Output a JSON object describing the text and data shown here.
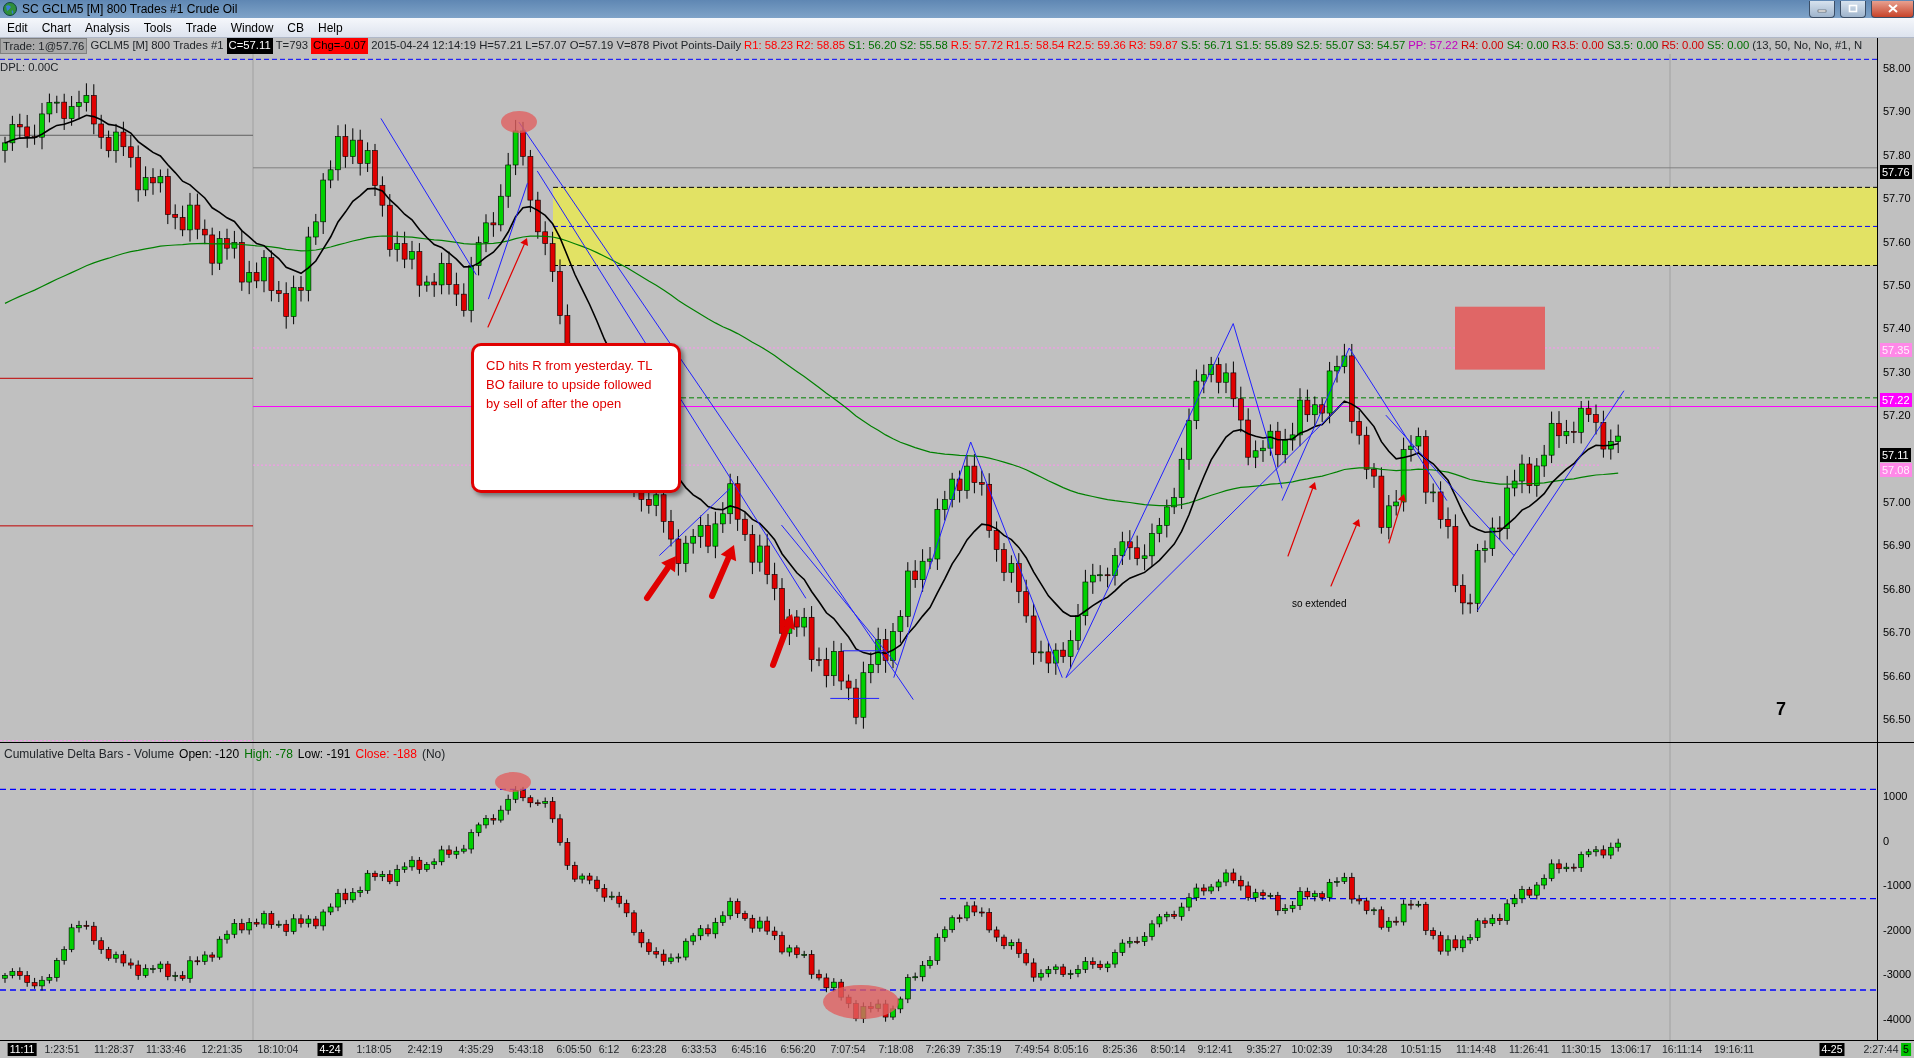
{
  "window": {
    "title": "SC GCLM5 [M]  800 Trades  #1  Crude Oil"
  },
  "menu": [
    "Edit",
    "Chart",
    "Analysis",
    "Tools",
    "Trade",
    "Window",
    "CB",
    "Help"
  ],
  "info_bar": [
    {
      "text": "Trade: 1@57.76",
      "kind": "boxed"
    },
    {
      "text": "GCLM5 [M]  800 Trades  #1",
      "kind": "plain"
    },
    {
      "text": "C=57.11",
      "kind": "inverse"
    },
    {
      "text": "T=793",
      "kind": "plain"
    },
    {
      "text": "Chg=-0.07",
      "kind": "alert"
    },
    {
      "text": "2015-04-24 12:14:19 H=57.21 L=57.07 O=57.19 V=878 Pivot Points-Daily",
      "kind": "plain"
    }
  ],
  "pivot_levels": [
    {
      "text": "R1: 58.23",
      "color": "#ff0000"
    },
    {
      "text": "R2: 58.85",
      "color": "#ff0000"
    },
    {
      "text": "S1: 56.20",
      "color": "#007000"
    },
    {
      "text": "S2: 55.58",
      "color": "#007000"
    },
    {
      "text": "R.5: 57.72",
      "color": "#ff0000"
    },
    {
      "text": "R1.5: 58.54",
      "color": "#ff0000"
    },
    {
      "text": "R2.5: 59.36",
      "color": "#ff0000"
    },
    {
      "text": "R3: 59.87",
      "color": "#ff0000"
    },
    {
      "text": "S.5: 56.71",
      "color": "#007000"
    },
    {
      "text": "S1.5: 55.89",
      "color": "#007000"
    },
    {
      "text": "S2.5: 55.07",
      "color": "#007000"
    },
    {
      "text": "S3: 54.57",
      "color": "#007000"
    },
    {
      "text": "PP: 57.22",
      "color": "#c000c0"
    },
    {
      "text": "R4: 0.00",
      "color": "#d00000"
    },
    {
      "text": "S4: 0.00",
      "color": "#007000"
    },
    {
      "text": "R3.5: 0.00",
      "color": "#d00000"
    },
    {
      "text": "S3.5: 0.00",
      "color": "#007000"
    },
    {
      "text": "R5: 0.00",
      "color": "#d00000"
    },
    {
      "text": "S5: 0.00",
      "color": "#007000"
    }
  ],
  "study_params": "(13, 50, No, No, #1, N",
  "dpl": "DPL: 0.00C",
  "price_axis": [
    "58.00",
    "57.90",
    "57.80",
    "57.70",
    "57.60",
    "57.50",
    "57.40",
    "57.30",
    "57.20",
    "57.00",
    "56.90",
    "56.80",
    "56.70",
    "56.60",
    "56.50"
  ],
  "price_tags": [
    {
      "text": "57.76",
      "color": "#000000"
    },
    {
      "text": "57.35",
      "color": "#ff88e8"
    },
    {
      "text": "57.22",
      "color": "#ff00ff"
    },
    {
      "text": "57.11",
      "color": "#000000"
    },
    {
      "text": "57.08",
      "color": "#ff88e8"
    }
  ],
  "annotations": {
    "callout": "CD hits R from yesterday.  TL BO failure to upside followed by sell of after the open",
    "note": "so extended",
    "marker": "7"
  },
  "delta_panel": {
    "title": "Cumulative Delta Bars - Volume",
    "stats": [
      {
        "text": "Open: -120",
        "color": "#000000"
      },
      {
        "text": "High: -78",
        "color": "#007000"
      },
      {
        "text": "Low: -191",
        "color": "#000000"
      },
      {
        "text": "Close: -188",
        "color": "#ff0000"
      }
    ],
    "flag": "(No)",
    "axis": [
      "1000",
      "0",
      "-1000",
      "-2000",
      "-3000",
      "-4000"
    ]
  },
  "time_axis": [
    {
      "text": "11:11",
      "kind": "date"
    },
    {
      "text": "1:23:51",
      "kind": "time"
    },
    {
      "text": "11:28:37",
      "kind": "time"
    },
    {
      "text": "11:33:46",
      "kind": "time"
    },
    {
      "text": "12:21:35",
      "kind": "time"
    },
    {
      "text": "18:10:04",
      "kind": "time"
    },
    {
      "text": "4-24",
      "kind": "date"
    },
    {
      "text": "1:18:05",
      "kind": "time"
    },
    {
      "text": "2:42:19",
      "kind": "time"
    },
    {
      "text": "4:35:29",
      "kind": "time"
    },
    {
      "text": "5:43:18",
      "kind": "time"
    },
    {
      "text": "6:05:50",
      "kind": "time"
    },
    {
      "text": "6:12",
      "kind": "time"
    },
    {
      "text": "6:23:28",
      "kind": "time"
    },
    {
      "text": "6:33:53",
      "kind": "time"
    },
    {
      "text": "6:45:16",
      "kind": "time"
    },
    {
      "text": "6:56:20",
      "kind": "time"
    },
    {
      "text": "7:07:54",
      "kind": "time"
    },
    {
      "text": "7:18:08",
      "kind": "time"
    },
    {
      "text": "7:26:39",
      "kind": "time"
    },
    {
      "text": "7:35:19",
      "kind": "time"
    },
    {
      "text": "7:49:54",
      "kind": "time"
    },
    {
      "text": "8:05:16",
      "kind": "time"
    },
    {
      "text": "8:25:36",
      "kind": "time"
    },
    {
      "text": "8:50:14",
      "kind": "time"
    },
    {
      "text": "9:12:41",
      "kind": "time"
    },
    {
      "text": "9:35:27",
      "kind": "time"
    },
    {
      "text": "10:02:39",
      "kind": "time"
    },
    {
      "text": "10:34:28",
      "kind": "time"
    },
    {
      "text": "10:51:15",
      "kind": "time"
    },
    {
      "text": "11:14:48",
      "kind": "time"
    },
    {
      "text": "11:26:41",
      "kind": "time"
    },
    {
      "text": "11:30:15",
      "kind": "time"
    },
    {
      "text": "13:06:17",
      "kind": "time"
    },
    {
      "text": "16:11:14",
      "kind": "time"
    },
    {
      "text": "19:16:11",
      "kind": "time"
    },
    {
      "text": "4-25",
      "kind": "date"
    },
    {
      "text": "2:27:44",
      "kind": "time"
    },
    {
      "text": "5",
      "kind": "marker"
    }
  ]
}
